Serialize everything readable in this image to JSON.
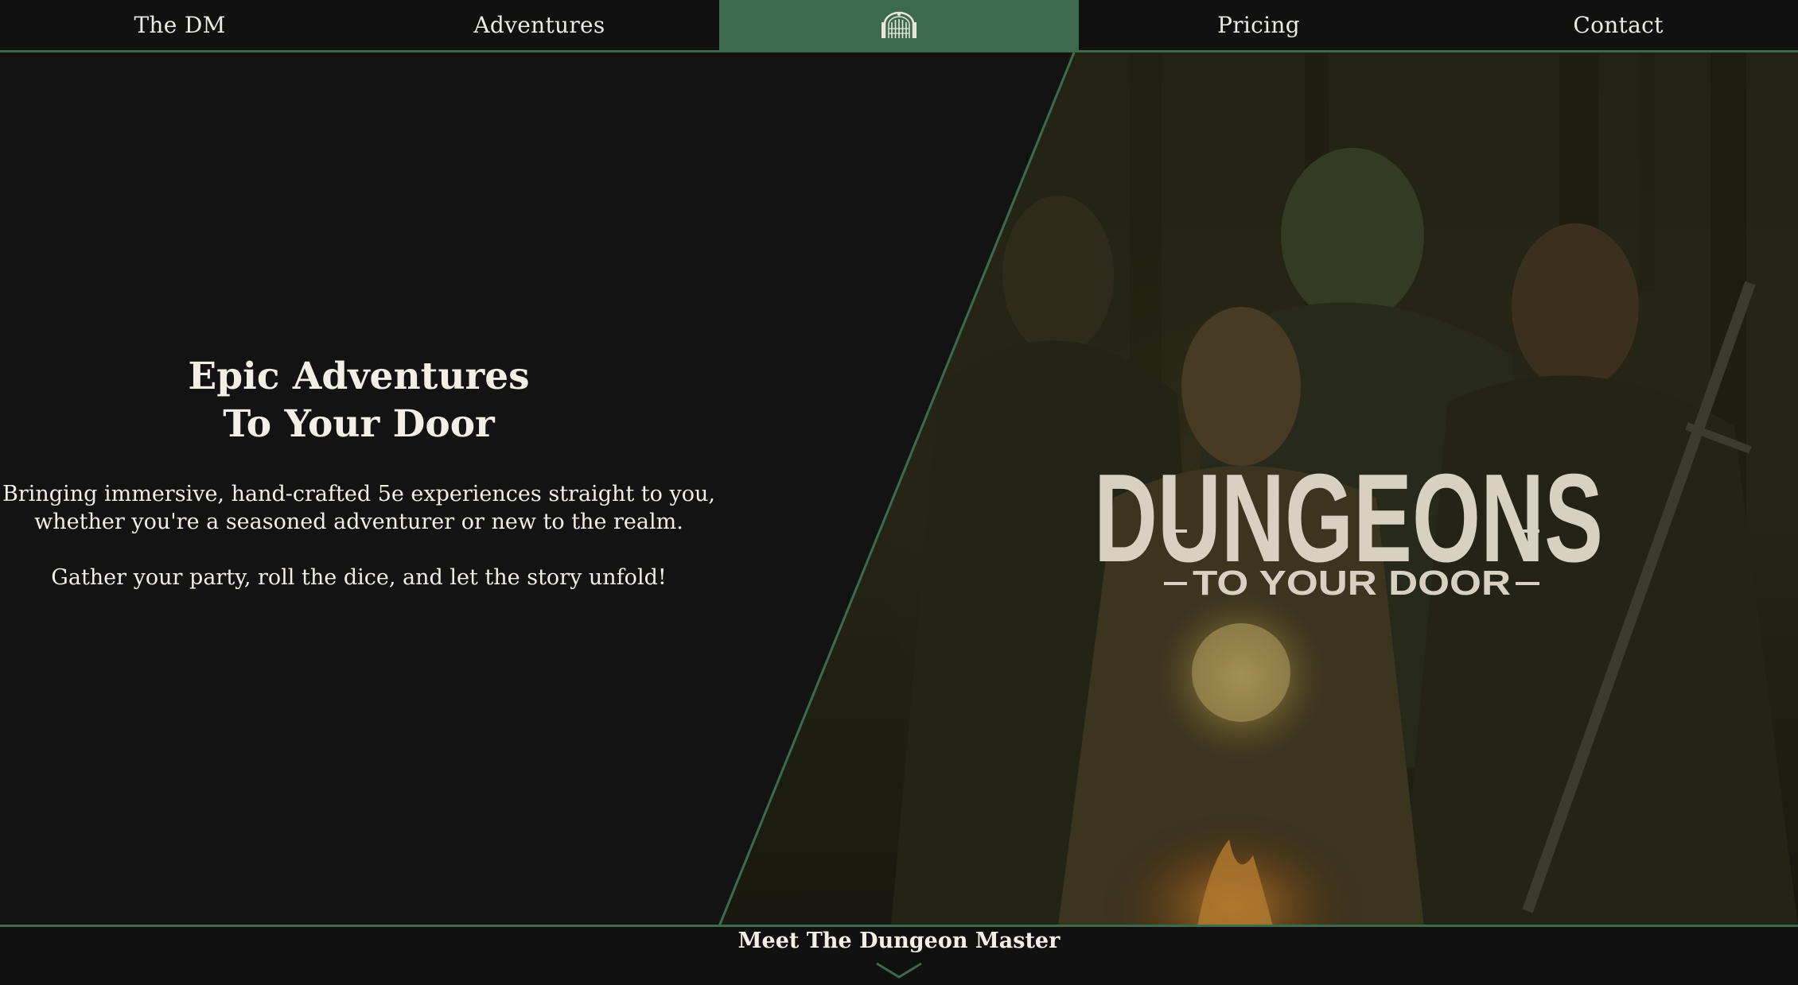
{
  "nav": {
    "items": [
      {
        "label": "The DM"
      },
      {
        "label": "Adventures"
      },
      {
        "label": "",
        "icon": "gate-icon"
      },
      {
        "label": "Pricing"
      },
      {
        "label": "Contact"
      }
    ]
  },
  "hero": {
    "title_line1": "Epic Adventures",
    "title_line2": "To Your Door",
    "desc_line1": "Bringing immersive, hand-crafted 5e experiences straight to you,",
    "desc_line2": "whether you're a seasoned adventurer or new to the realm.",
    "cta": "Gather your party, roll the dice, and let the story unfold!",
    "logo_word": "DUNGEONS",
    "logo_tagline": "TO YOUR DOOR"
  },
  "footer": {
    "meet_label": "Meet The Dungeon Master",
    "chevron_icon": "chevron-down-icon"
  },
  "colors": {
    "accent": "#3d6a4d",
    "background": "#131313",
    "text": "#f1efe6"
  }
}
